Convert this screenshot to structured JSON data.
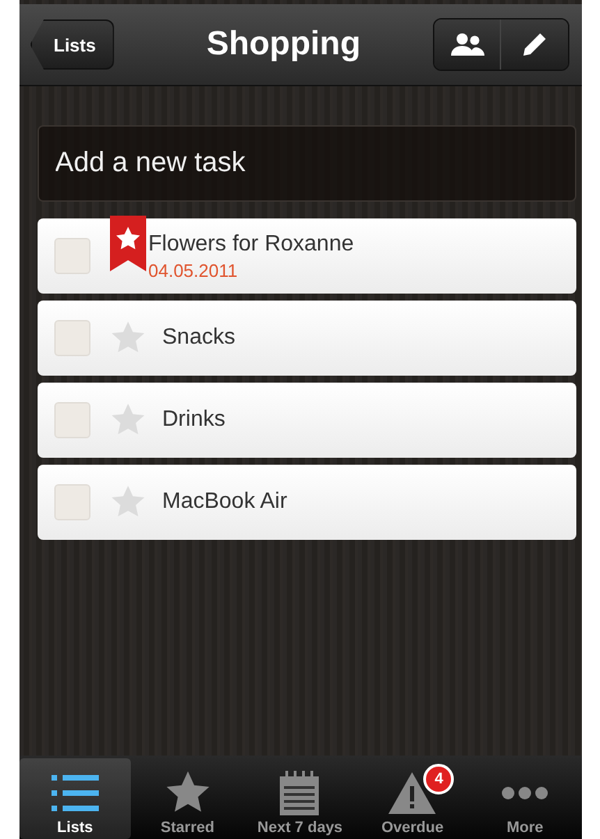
{
  "nav": {
    "back": "Lists",
    "title": "Shopping"
  },
  "new_task": {
    "placeholder": "Add a new task"
  },
  "tasks": [
    {
      "title": "Flowers for Roxanne",
      "due": "04.05.2011",
      "checked": false,
      "starred": true
    },
    {
      "title": "Snacks",
      "checked": false,
      "starred": false
    },
    {
      "title": "Drinks",
      "checked": false,
      "starred": false
    },
    {
      "title": "MacBook Air",
      "checked": false,
      "starred": false
    }
  ],
  "tabs": [
    {
      "label": "Lists",
      "kind": "list",
      "selected": true
    },
    {
      "label": "Starred",
      "kind": "star",
      "selected": false
    },
    {
      "label": "Next 7 days",
      "kind": "calendar",
      "selected": false
    },
    {
      "label": "Overdue",
      "kind": "warning",
      "selected": false,
      "badge": "4"
    },
    {
      "label": "More",
      "kind": "dots",
      "selected": false
    }
  ]
}
